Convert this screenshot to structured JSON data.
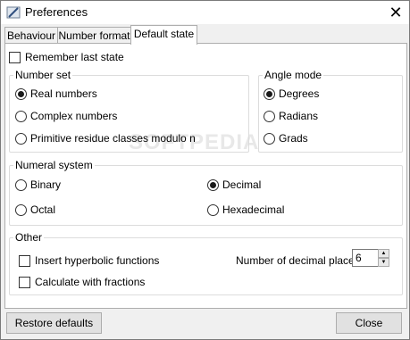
{
  "window": {
    "title": "Preferences",
    "close_glyph": "✕",
    "icon": "preferences-app-icon"
  },
  "tabs": [
    {
      "label": "Behaviour",
      "active": false
    },
    {
      "label": "Number format",
      "active": false
    },
    {
      "label": "Default state",
      "active": true
    }
  ],
  "remember_last_state": {
    "label": "Remember last state",
    "checked": false
  },
  "number_set": {
    "title": "Number set",
    "options": [
      {
        "label": "Real numbers",
        "selected": true
      },
      {
        "label": "Complex numbers",
        "selected": false
      },
      {
        "label": "Primitive residue classes modulo n",
        "selected": false
      }
    ]
  },
  "angle_mode": {
    "title": "Angle mode",
    "options": [
      {
        "label": "Degrees",
        "selected": true
      },
      {
        "label": "Radians",
        "selected": false
      },
      {
        "label": "Grads",
        "selected": false
      }
    ]
  },
  "numeral_system": {
    "title": "Numeral system",
    "options": [
      {
        "label": "Binary",
        "selected": false
      },
      {
        "label": "Decimal",
        "selected": true
      },
      {
        "label": "Octal",
        "selected": false
      },
      {
        "label": "Hexadecimal",
        "selected": false
      }
    ]
  },
  "other": {
    "title": "Other",
    "insert_hyperbolic": {
      "label": "Insert hyperbolic functions",
      "checked": false
    },
    "calc_fractions": {
      "label": "Calculate with fractions",
      "checked": false
    },
    "decimal_places": {
      "label": "Number of decimal places:",
      "value": "6"
    }
  },
  "buttons": {
    "restore": "Restore defaults",
    "close": "Close"
  },
  "watermark": "SOFTPEDIA"
}
